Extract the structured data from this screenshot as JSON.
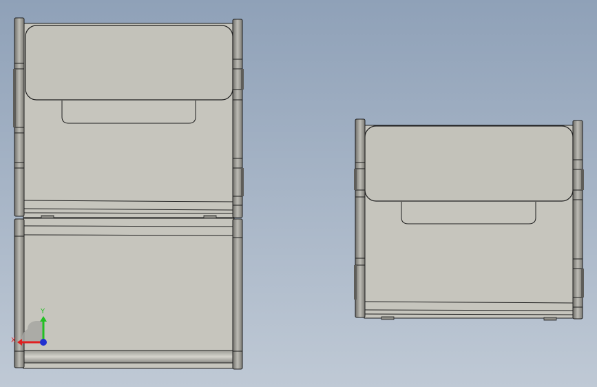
{
  "viewport": {
    "background_top": "#8fa1b8",
    "background_bottom": "#bfc9d5"
  },
  "model": {
    "face_color": "#c6c5bd",
    "edge_color": "#1e1e1e",
    "shade_color": "#8c8b85",
    "hole_color": "#ececea"
  },
  "triad": {
    "x_label": "X",
    "y_label": "Y",
    "x_color": "#e02020",
    "y_color": "#22c022",
    "z_color": "#2030d0"
  }
}
